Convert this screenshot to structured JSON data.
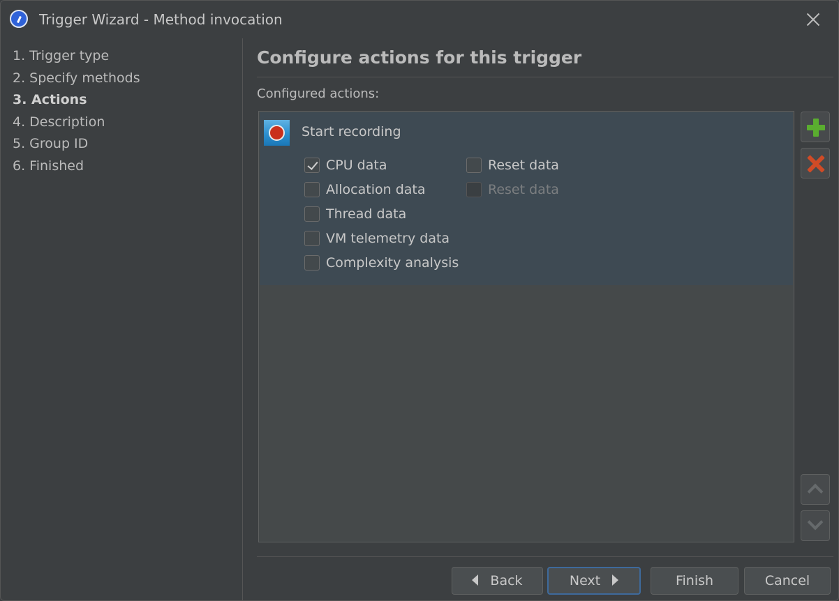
{
  "window": {
    "title": "Trigger Wizard - Method invocation",
    "icon": "profiler-gauge-icon"
  },
  "steps": [
    {
      "label": "1. Trigger type",
      "active": false
    },
    {
      "label": "2. Specify methods",
      "active": false
    },
    {
      "label": "3. Actions",
      "active": true
    },
    {
      "label": "4. Description",
      "active": false
    },
    {
      "label": "5. Group ID",
      "active": false
    },
    {
      "label": "6. Finished",
      "active": false
    }
  ],
  "main": {
    "heading": "Configure actions for this trigger",
    "list_label": "Configured actions:",
    "actions": [
      {
        "name": "Start recording",
        "icon": "record-icon",
        "options": [
          {
            "label": "CPU data",
            "checked": true,
            "enabled": true
          },
          {
            "label": "Allocation data",
            "checked": false,
            "enabled": true
          },
          {
            "label": "Thread data",
            "checked": false,
            "enabled": true
          },
          {
            "label": "VM telemetry data",
            "checked": false,
            "enabled": true
          },
          {
            "label": "Complexity analysis",
            "checked": false,
            "enabled": true
          }
        ],
        "reset_options": [
          {
            "label": "Reset data",
            "checked": false,
            "enabled": true
          },
          {
            "label": "Reset data",
            "checked": false,
            "enabled": false
          }
        ]
      }
    ]
  },
  "side_buttons": {
    "add": "plus-icon",
    "remove": "delete-x-icon",
    "move_up": "chevron-up-icon",
    "move_down": "chevron-down-icon"
  },
  "footer": {
    "back_label": "Back",
    "next_label": "Next",
    "finish_label": "Finish",
    "cancel_label": "Cancel"
  },
  "colors": {
    "background": "#3c3f41",
    "selection": "#3e4a53",
    "add_icon": "#5aad2f",
    "remove_icon": "#d04b26",
    "record_icon": "#c9301d",
    "default_button_border": "#3e6a9c"
  }
}
